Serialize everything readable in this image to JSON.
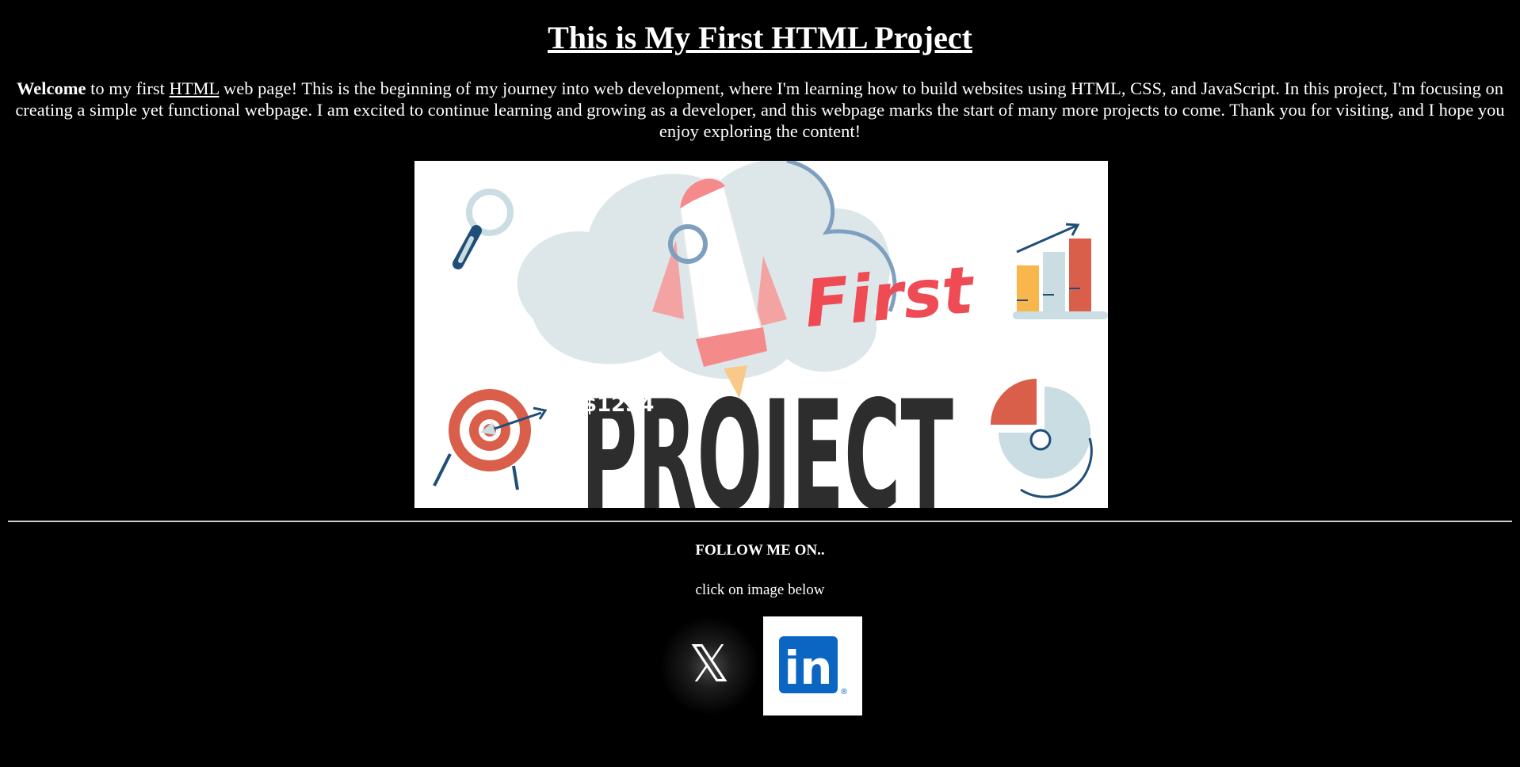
{
  "header": {
    "title": "This is My First HTML Project"
  },
  "intro": {
    "bold_word": "Welcome",
    "text_before_link": " to my first ",
    "link_text": "HTML",
    "text_after_link": " web page! This is the beginning of my journey into web development, where I'm learning how to build websites using HTML, CSS, and JavaScript. In this project, I'm focusing on creating a simple yet functional webpage. I am excited to continue learning and growing as a developer, and this webpage marks the start of many more projects to come. Thank you for visiting, and I hope you enjoy exploring the content!"
  },
  "hero_image": {
    "word_top": "First",
    "word_main": "PROJECT",
    "stamp_text": "$1234",
    "colors": {
      "red": "#ef4b55",
      "dark": "#2d2d2d",
      "cloud": "#dde7ea",
      "navy": "#1f4e79",
      "orange": "#d95f4a",
      "yellow": "#f8b64c"
    }
  },
  "footer": {
    "follow_heading": "FOLLOW ME ON..",
    "hint": "click on image below",
    "x_glyph": "𝕏",
    "linkedin_text": "in",
    "linkedin_mark": "®",
    "linkedin_color": "#0a66c2"
  }
}
